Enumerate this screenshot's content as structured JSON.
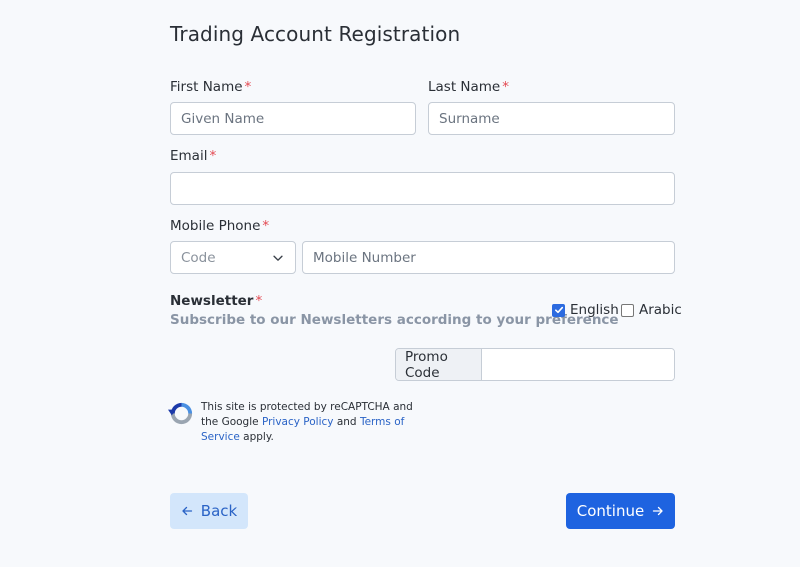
{
  "form": {
    "title": "Trading Account Registration",
    "required_mark": "*",
    "first_name": {
      "label": "First Name",
      "placeholder": "Given Name",
      "value": ""
    },
    "last_name": {
      "label": "Last Name",
      "placeholder": "Surname",
      "value": ""
    },
    "email": {
      "label": "Email",
      "placeholder": "",
      "value": ""
    },
    "mobile_phone": {
      "label": "Mobile Phone",
      "code_select": {
        "selected": "Code"
      },
      "number_placeholder": "Mobile Number"
    },
    "newsletter": {
      "label": "Newsletter",
      "subtitle": "Subscribe to our Newsletters according to your preference",
      "options": [
        {
          "label": "English",
          "checked": true
        },
        {
          "label": "Arabic",
          "checked": false
        }
      ]
    },
    "promo": {
      "addon_label": "Promo Code",
      "value": ""
    },
    "recaptcha": {
      "text_before": "This site is protected by reCAPTCHA and the Google ",
      "privacy_link": "Privacy Policy",
      "and": " and ",
      "terms_link": "Terms of Service",
      "text_after": " apply.",
      "icon": "recaptcha-logo-icon"
    },
    "buttons": {
      "back_label": "Back",
      "continue_label": "Continue",
      "back_icon": "arrow-left-icon",
      "continue_icon": "arrow-right-icon"
    }
  },
  "colors": {
    "primary": "#1e63e0",
    "secondary_bg": "#d3e6fb",
    "required": "#e34850",
    "link": "#2a63c6",
    "muted": "#8a95a5"
  }
}
